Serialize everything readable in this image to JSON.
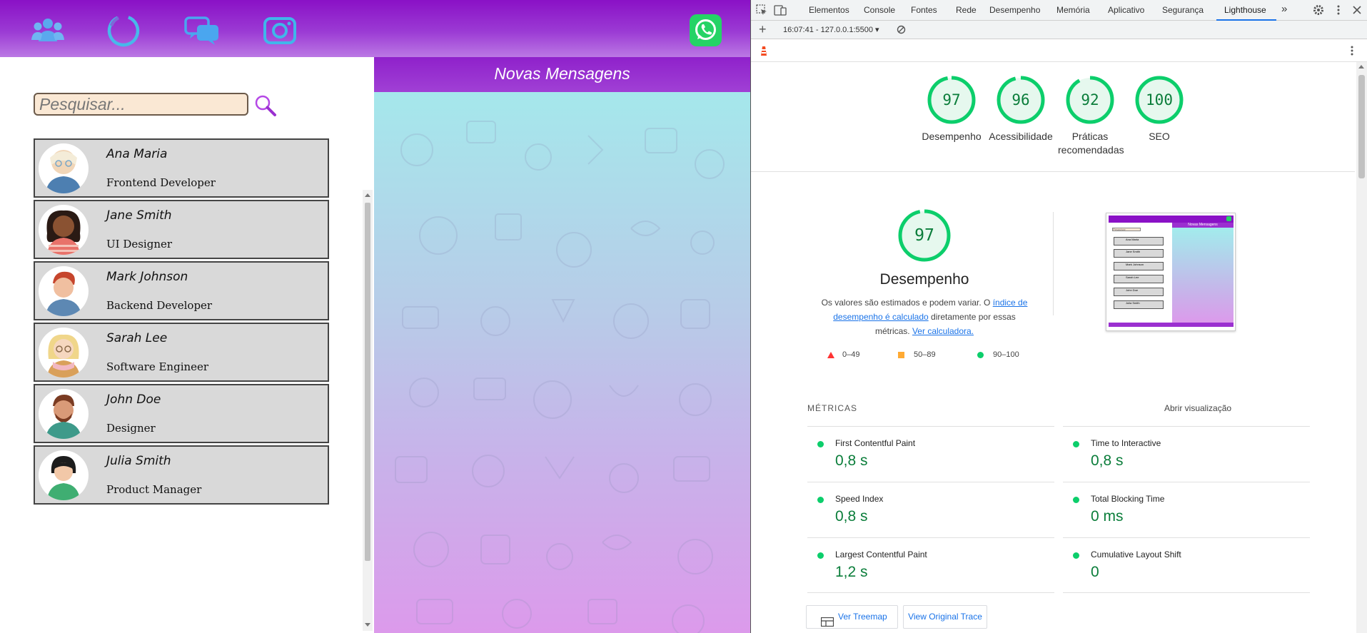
{
  "app": {
    "topbar": {
      "icons": [
        "contacts-icon",
        "status-icon",
        "chats-icon",
        "camera-icon"
      ],
      "whatsapp_icon": "whatsapp-logo-icon"
    },
    "search": {
      "placeholder": "Pesquisar...",
      "value": ""
    },
    "contacts": [
      {
        "name": "Ana Maria",
        "role": "Frontend Developer"
      },
      {
        "name": "Jane Smith",
        "role": "UI Designer"
      },
      {
        "name": "Mark Johnson",
        "role": "Backend Developer"
      },
      {
        "name": "Sarah Lee",
        "role": "Software Engineer"
      },
      {
        "name": "John Doe",
        "role": "Designer"
      },
      {
        "name": "Julia Smith",
        "role": "Product Manager"
      }
    ],
    "chat": {
      "header": "Novas Mensagens"
    },
    "colors": {
      "primary": "#8a11c6",
      "card": "#d9d9d9",
      "search_bg": "#fae8d4",
      "whatsapp": "#25d366"
    }
  },
  "devtools": {
    "tabs": [
      "Elementos",
      "Console",
      "Fontes",
      "Rede",
      "Desempenho",
      "Memória",
      "Aplicativo",
      "Segurança",
      "Lighthouse"
    ],
    "active_tab": "Lighthouse",
    "report_selector": "16:07:41 - 127.0.0.1:5500",
    "scores": [
      {
        "value": "97",
        "label": "Desempenho"
      },
      {
        "value": "96",
        "label": "Acessibilidade"
      },
      {
        "value": "92",
        "label": "Práticas recomendadas"
      },
      {
        "value": "100",
        "label": "SEO"
      }
    ],
    "performance": {
      "score": "97",
      "title": "Desempenho",
      "desc_1": "Os valores são estimados e podem variar. O ",
      "desc_link_1": "índice de desempenho é calculado",
      "desc_2": " diretamente por essas métricas. ",
      "desc_link_2": "Ver calculadora."
    },
    "legend": [
      {
        "label": "0–49",
        "color": "#ff3333"
      },
      {
        "label": "50–89",
        "color": "#ffaa33"
      },
      {
        "label": "90–100",
        "color": "#0cce6b"
      }
    ],
    "metrics_title": "MÉTRICAS",
    "expand_view": "Abrir visualização",
    "metrics": [
      {
        "name": "First Contentful Paint",
        "value": "0,8 s"
      },
      {
        "name": "Time to Interactive",
        "value": "0,8 s"
      },
      {
        "name": "Speed Index",
        "value": "0,8 s"
      },
      {
        "name": "Total Blocking Time",
        "value": "0 ms"
      },
      {
        "name": "Largest Contentful Paint",
        "value": "1,2 s"
      },
      {
        "name": "Cumulative Layout Shift",
        "value": "0"
      }
    ],
    "buttons": {
      "treemap": "Ver Treemap",
      "trace": "View Original Trace"
    },
    "thumbnail": {
      "header": "Novas Mensagens",
      "search": "Pesquisar",
      "rows": [
        "Ana Maria",
        "Jane Smith",
        "Mark Johnson",
        "Sarah Lee",
        "John Doe",
        "Julia Smith"
      ]
    }
  }
}
